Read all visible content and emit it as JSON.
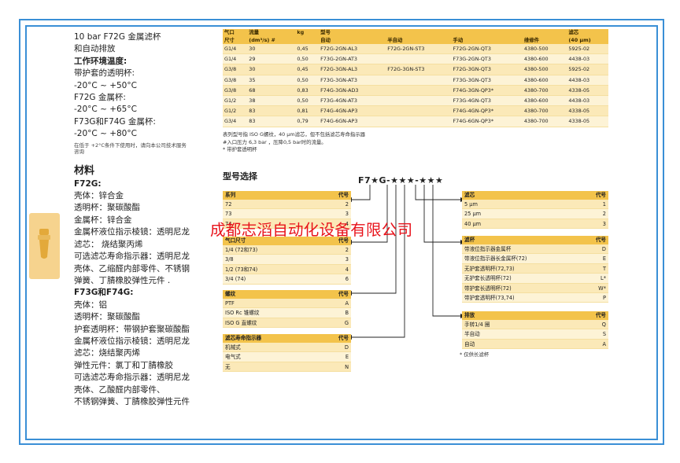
{
  "left_column": {
    "lines": [
      {
        "text": "10 bar F72G 金属滤杯",
        "style": "normal"
      },
      {
        "text": "和自动排放",
        "style": "normal"
      },
      {
        "text": "工作环境温度:",
        "style": "bold"
      },
      {
        "text": "带护套的透明杯:",
        "style": "normal"
      },
      {
        "text": "-20°C ~ +50°C",
        "style": "normal"
      },
      {
        "text": "F72G 金属杯:",
        "style": "normal"
      },
      {
        "text": "-20°C ~ +65°C",
        "style": "normal"
      },
      {
        "text": "F73G和F74G 金属杯:",
        "style": "normal"
      },
      {
        "text": "-20°C ~ +80°C",
        "style": "normal"
      }
    ],
    "small_note": [
      "在低于 +2°C条件下使用时，请向本公司技术服务",
      "咨询"
    ],
    "materials_title": "材料",
    "materials_lines": [
      {
        "text": "F72G:",
        "style": "bold"
      },
      {
        "text": "壳体：锌合金",
        "style": "normal"
      },
      {
        "text": "透明杯：聚碳酸酯",
        "style": "normal"
      },
      {
        "text": "金属杯：锌合金",
        "style": "normal"
      },
      {
        "text": "金属杯液位指示棱镜：透明尼龙",
        "style": "normal"
      },
      {
        "text": "滤芯：  烧结聚丙烯",
        "style": "normal"
      },
      {
        "text": "可选滤芯寿命指示器：透明尼龙",
        "style": "normal"
      },
      {
        "text": "壳体、乙缩醛内部零件、不锈钢",
        "style": "normal"
      },
      {
        "text": "弹簧、丁腈橡胶弹性元件 .",
        "style": "normal"
      },
      {
        "text": "F73G和F74G:",
        "style": "bold"
      },
      {
        "text": "壳体：铝",
        "style": "normal"
      },
      {
        "text": "透明杯：聚碳酸酯",
        "style": "normal"
      },
      {
        "text": "护套透明杯：带钢护套聚碳酸酯",
        "style": "normal"
      },
      {
        "text": "金属杯液位指示棱镜：透明尼龙",
        "style": "normal"
      },
      {
        "text": "滤芯：烧结聚丙烯",
        "style": "normal"
      },
      {
        "text": "弹性元件：氯丁和丁腈橡胶",
        "style": "normal"
      },
      {
        "text": "可选滤芯寿命指示器：透明尼龙",
        "style": "normal"
      },
      {
        "text": "壳体、乙酸醛内部零件、",
        "style": "normal"
      },
      {
        "text": "不锈钢弹簧、丁腈橡胶弹性元件",
        "style": "normal"
      }
    ]
  },
  "spec_table": {
    "header_row1": [
      "气口",
      "流量",
      "kg",
      "型号",
      "",
      "",
      "",
      "滤芯"
    ],
    "header_row2": [
      "尺寸",
      "(dm³/s) #",
      "",
      "自动",
      "半自动",
      "手动",
      "维修件",
      "(40 μm)"
    ],
    "rows": [
      [
        "G1/4",
        "30",
        "0,45",
        "F72G-2GN-AL3",
        "F72G-2GN-ST3",
        "F72G-2GN-QT3",
        "4380-500",
        "5925-02"
      ],
      [
        "G1/4",
        "29",
        "0,50",
        "F73G-2GN-AT3",
        "",
        "F73G-2GN-QT3",
        "4380-600",
        "4438-03"
      ],
      [
        "G3/8",
        "30",
        "0,45",
        "F72G-3GN-AL3",
        "F72G-3GN-ST3",
        "F72G-3GN-QT3",
        "4380-500",
        "5925-02"
      ],
      [
        "G3/8",
        "35",
        "0,50",
        "F73G-3GN-AT3",
        "",
        "F73G-3GN-QT3",
        "4380-600",
        "4438-03"
      ],
      [
        "G3/8",
        "68",
        "0,83",
        "F74G-3GN-AD3",
        "",
        "F74G-3GN-QP3*",
        "4380-700",
        "4338-05"
      ],
      [
        "G1/2",
        "38",
        "0,50",
        "F73G-4GN-AT3",
        "",
        "F73G-4GN-QT3",
        "4380-600",
        "4438-03"
      ],
      [
        "G1/2",
        "83",
        "0,81",
        "F74G-4GN-AP3",
        "",
        "F74G-4GN-QP3*",
        "4380-700",
        "4338-05"
      ],
      [
        "G3/4",
        "83",
        "0,79",
        "F74G-6GN-AP3",
        "",
        "F74G-6GN-QP3*",
        "4380-700",
        "4338-05"
      ]
    ]
  },
  "notes": [
    "表列型号指 ISO G螺纹，40 μm滤芯，但不包括滤芯寿命指示器",
    "#入口压力 6,3 bar ，压降0,5 bar时的流量。",
    "* 带护套透明杯"
  ],
  "selection": {
    "title": "型号选择",
    "code": "F7★G-★★★-★★★",
    "tables": {
      "series": {
        "header": [
          "系列",
          "代号"
        ],
        "rows": [
          [
            "72",
            "2"
          ],
          [
            "73",
            "3"
          ],
          [
            "74",
            "4"
          ]
        ]
      },
      "port": {
        "header": [
          "气口尺寸",
          "代号"
        ],
        "rows": [
          [
            "1/4 (72和73)",
            "2"
          ],
          [
            "3/8",
            "3"
          ],
          [
            "1/2 (73和74)",
            "4"
          ],
          [
            "3/4 (74)",
            "6"
          ]
        ]
      },
      "thread": {
        "header": [
          "螺纹",
          "代号"
        ],
        "rows": [
          [
            "PTF",
            "A"
          ],
          [
            "ISO Rc 锥螺纹",
            "B"
          ],
          [
            "ISO G 直螺纹",
            "G"
          ]
        ]
      },
      "life": {
        "header": [
          "滤芯寿命指示器",
          "代号"
        ],
        "rows": [
          [
            "机械式",
            "D"
          ],
          [
            "电气式",
            "E"
          ],
          [
            "无",
            "N"
          ]
        ]
      },
      "element": {
        "header": [
          "滤芯",
          "代号"
        ],
        "rows": [
          [
            "5 μm",
            "1"
          ],
          [
            "25 μm",
            "2"
          ],
          [
            "40 μm",
            "3"
          ]
        ]
      },
      "bowl": {
        "header": [
          "滤杯",
          "代号"
        ],
        "rows": [
          [
            "带液位指示器金属杯",
            "D"
          ],
          [
            "带液位指示器长金属杯(72)",
            "E"
          ],
          [
            "无护套透明杯(72,73)",
            "T"
          ],
          [
            "无护套长透明杯(72)",
            "L*"
          ],
          [
            "带护套长透明杯(72)",
            "W*"
          ],
          [
            "带护套透明杯(73,74)",
            "P"
          ]
        ]
      },
      "drain": {
        "header": [
          "排放",
          "代号"
        ],
        "rows": [
          [
            "手转1/4 圈",
            "Q"
          ],
          [
            "半自动",
            "S"
          ],
          [
            "自动",
            "A"
          ]
        ]
      }
    },
    "footnote": "* 仅供长滤杯"
  },
  "watermark": "成都志滔自动化设备有限公司",
  "colors": {
    "frame": "#3a8fd6",
    "header_fill": "#f3c34b",
    "row_fill": "#fbe9b8",
    "watermark": "#e8121a"
  }
}
